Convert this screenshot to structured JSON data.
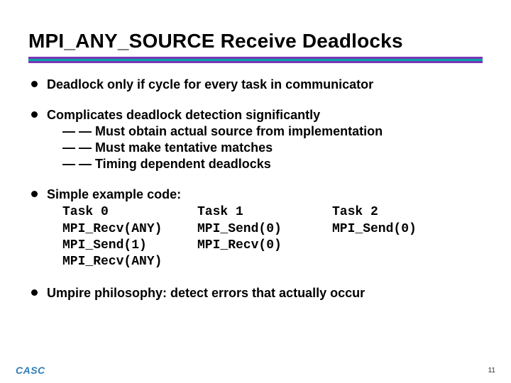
{
  "title": "MPI_ANY_SOURCE Receive Deadlocks",
  "bullets": {
    "b1": "Deadlock only if cycle for every task in communicator",
    "b2": "Complicates deadlock detection significantly",
    "b2_subs": {
      "s1": "Must obtain actual source from implementation",
      "s2": "Must make tentative matches",
      "s3": "Timing dependent deadlocks"
    },
    "b3": "Simple example code:",
    "b4": "Umpire philosophy: detect errors that actually occur"
  },
  "example": {
    "col1": {
      "h": "Task 0",
      "l1": "MPI_Recv(ANY)",
      "l2": "MPI_Send(1)",
      "l3": "MPI_Recv(ANY)"
    },
    "col2": {
      "h": "Task 1",
      "l1": "MPI_Send(0)",
      "l2": "MPI_Recv(0)"
    },
    "col3": {
      "h": "Task 2",
      "l1": "MPI_Send(0)"
    }
  },
  "footer": "CASC",
  "page": "11"
}
